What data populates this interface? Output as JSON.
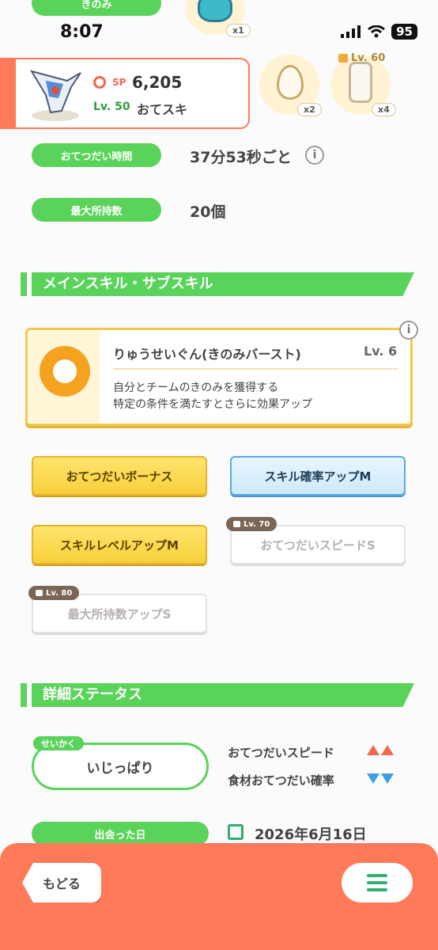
{
  "status_bar": {
    "time": "8:07",
    "battery": "95"
  },
  "top_strip": {
    "berry_label": "きのみ",
    "berry_count": "x1"
  },
  "pokemon": {
    "sp_label": "SP",
    "sp_value": "6,205",
    "level": "Lv. 50",
    "name": "おてスキ",
    "egg_count": "x2",
    "milk_count": "x4",
    "milk_lock_level": "Lv. 60"
  },
  "info_rows": {
    "help_time_label": "おてつだい時間",
    "help_time_value": "37分53秒ごと",
    "max_carry_label": "最大所持数",
    "max_carry_value": "20個"
  },
  "skills_section": {
    "title": "メインスキル・サブスキル",
    "main_skill": {
      "name": "りゅうせいぐん(きのみバースト)",
      "level": "Lv. 6",
      "desc_line1": "自分とチームのきのみを獲得する",
      "desc_line2": "特定の条件を満たすとさらに効果アップ"
    },
    "sub_skills": [
      {
        "label": "おてつだいボーナス"
      },
      {
        "label": "スキル確率アップM"
      },
      {
        "label": "スキルレベルアップM"
      },
      {
        "label": "おてつだいスピードS",
        "lock": "Lv. 70"
      },
      {
        "label": "最大所持数アップS",
        "lock": "Lv. 80"
      }
    ]
  },
  "detail_section": {
    "title": "詳細ステータス",
    "nature_tag": "せいかく",
    "nature": "いじっぱり",
    "effect_up": "おてつだいスピード",
    "effect_down": "食材おてつだい確率",
    "met_date_label": "出会った日",
    "met_date": "2026年6月16日"
  },
  "bottom_bar": {
    "back_label": "もどる"
  },
  "colors": {
    "accent_green": "#5ad35a",
    "accent_orange": "#ff7a59",
    "gold": "#f7cf3a",
    "blue": "#5aa7e6"
  }
}
